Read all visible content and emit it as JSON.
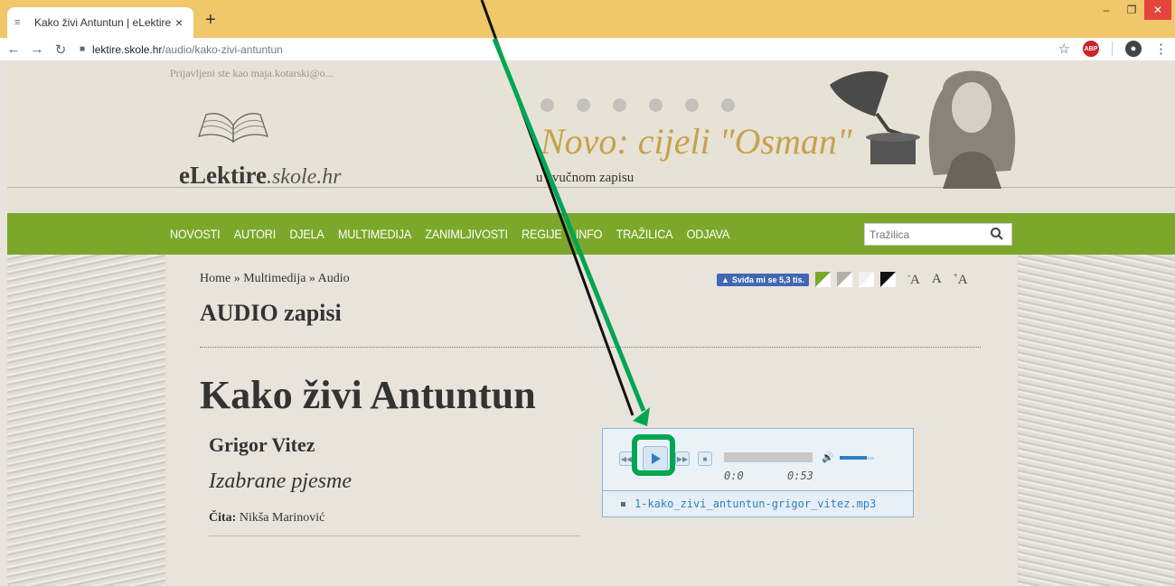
{
  "browser": {
    "tab_title": "Kako živi Antuntun | eLektire",
    "tab_close": "×",
    "new_tab": "+",
    "url_host": "lektire.skole.hr",
    "url_path": "/audio/kako-zivi-antuntun"
  },
  "header": {
    "login_text": "Prijavljeni ste kao maja.kotarski@o...",
    "logo_bold": "eLektire",
    "logo_italic": ".skole.hr",
    "promo_title": "Novo: cijeli \"Osman\"",
    "promo_subtitle": "u zvučnom zapisu"
  },
  "nav": {
    "items": [
      "NOVOSTI",
      "AUTORI",
      "DJELA",
      "MULTIMEDIJA",
      "ZANIMLJIVOSTI",
      "REGIJE",
      "INFO",
      "TRAŽILICA",
      "ODJAVA"
    ],
    "search_placeholder": "Tražilica"
  },
  "content": {
    "breadcrumb": "Home » Multimedija » Audio",
    "fb_like": "Sviđa mi se 5,3 tis.",
    "font_sizes": [
      "A",
      "A",
      "A"
    ],
    "page_title": "AUDIO zapisi",
    "work_title": "Kako živi Antuntun",
    "author": "Grigor Vitez",
    "collection": "Izabrane pjesme",
    "reader_label": "Čita:",
    "reader_name": "Nikša Marinović"
  },
  "player": {
    "time_current": "0:0",
    "time_total": "0:53",
    "progress": 0,
    "volume": 0.8,
    "track": "1-kako_zivi_antuntun-grigor_vitez.mp3"
  },
  "colors": {
    "nav_green": "#7ba82a",
    "promo_gold": "#c8a14a",
    "highlight_green": "#00a651",
    "player_blue": "#2f7fc1"
  }
}
